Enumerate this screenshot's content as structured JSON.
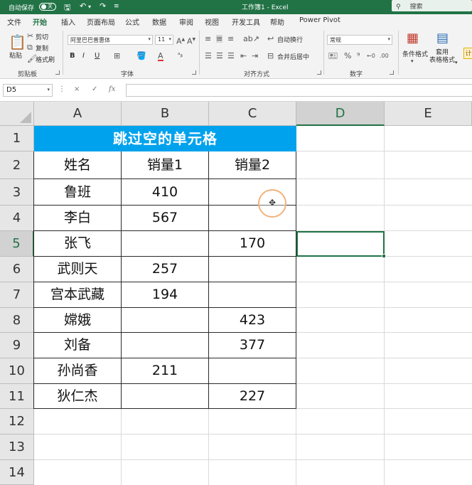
{
  "titlebar": {
    "autosave_label": "自动保存",
    "autosave_state": "关",
    "quick_access": [
      "save-icon",
      "undo-icon",
      "redo-icon",
      "customize-icon"
    ],
    "doc_title": "工作簿1 - Excel",
    "search_placeholder": "搜索"
  },
  "tabs": [
    "文件",
    "开始",
    "插入",
    "页面布局",
    "公式",
    "数据",
    "审阅",
    "视图",
    "开发工具",
    "帮助",
    "Power Pivot"
  ],
  "active_tab": "开始",
  "ribbon": {
    "clipboard": {
      "paste": "粘贴",
      "cut": "剪切",
      "copy": "复制",
      "format_painter": "格式刷",
      "label": "剪贴板"
    },
    "font": {
      "name": "阿里巴巴普惠体",
      "size": "11",
      "label": "字体",
      "bold": "B",
      "italic": "I",
      "underline": "U"
    },
    "alignment": {
      "wrap": "自动换行",
      "merge": "合并后居中",
      "label": "对齐方式"
    },
    "number": {
      "format": "常规",
      "label": "数字"
    },
    "styles": {
      "conditional": "条件格式",
      "table": "套用\n表格格式",
      "calc": "计"
    }
  },
  "formula_bar": {
    "name_box": "D5",
    "cancel": "×",
    "enter": "✓",
    "fx": "fx",
    "content": ""
  },
  "grid": {
    "columns": [
      "A",
      "B",
      "C",
      "D",
      "E"
    ],
    "selected_column": "D",
    "rows": [
      "1",
      "2",
      "3",
      "4",
      "5",
      "6",
      "7",
      "8",
      "9",
      "10",
      "11",
      "12",
      "13",
      "14"
    ],
    "selected_row": "5",
    "title": "跳过空的单元格",
    "headers": [
      "姓名",
      "销量1",
      "销量2"
    ],
    "data": [
      [
        "鲁班",
        "410",
        ""
      ],
      [
        "李白",
        "567",
        ""
      ],
      [
        "张飞",
        "",
        "170"
      ],
      [
        "武则天",
        "257",
        ""
      ],
      [
        "宫本武藏",
        "194",
        ""
      ],
      [
        "嫦娥",
        "",
        "423"
      ],
      [
        "刘备",
        "",
        "377"
      ],
      [
        "孙尚香",
        "211",
        ""
      ],
      [
        "狄仁杰",
        "",
        "227"
      ]
    ],
    "cursor_icon": "move-cursor-icon"
  }
}
